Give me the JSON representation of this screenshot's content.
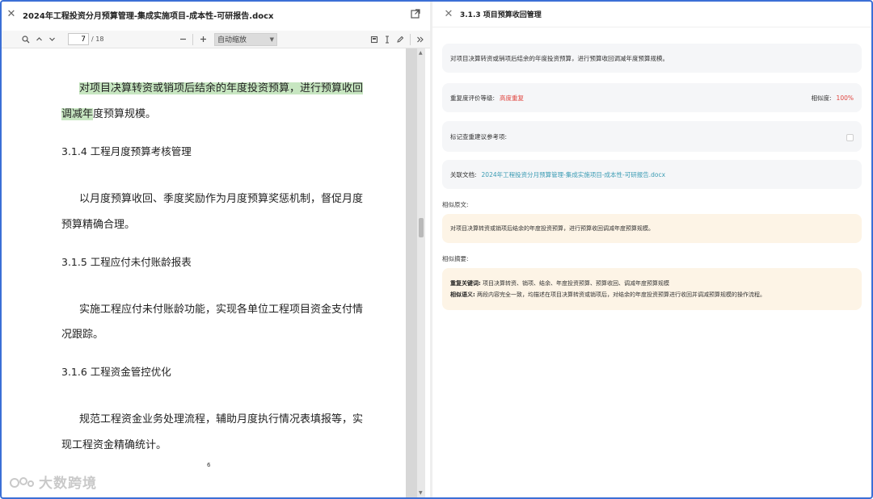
{
  "left": {
    "doc_title": "2024年工程投资分月预算管理-集成实施项目-成本性-可研报告.docx",
    "toolbar": {
      "page_current": "7",
      "page_total": "/ 18",
      "zoom": "自动缩放"
    },
    "document": {
      "para1_line1": "对项目决算转资或销项后结余的年度投资预算，进行预算收回",
      "para1_line2_hl": "调减年",
      "para1_line2_rest": "度预算规模。",
      "h314": "3.1.4 工程月度预算考核管理",
      "para2_line1": "以月度预算收回、季度奖励作为月度预算奖惩机制，督促月度",
      "para2_line2": "预算精确合理。",
      "h315": "3.1.5 工程应付未付账龄报表",
      "para3_line1": "实施工程应付未付账龄功能，实现各单位工程项目资金支付情",
      "para3_line2": "况跟踪。",
      "h316": "3.1.6 工程资金管控优化",
      "para4_line1": "规范工程资金业务处理流程，辅助月度执行情况表填报等，实",
      "para4_line2": "现工程资金精确统计。",
      "page_number": "6"
    },
    "watermark": "大数跨境"
  },
  "right": {
    "section_title": "3.1.3 项目预算收回管理",
    "card1_text": "对项目决算转资或销项后结余的年度投资预算，进行预算收回调减年度预算规模。",
    "card2": {
      "label": "重复度评价等级:",
      "level": "高度重复",
      "sim_label": "相似度:",
      "sim_value": "100%"
    },
    "card3_label": "标记查重建议参考项:",
    "card4": {
      "label": "关联文档:",
      "link": "2024年工程投资分月预算管理-集成实施项目-成本性-可研报告.docx"
    },
    "similar_text_label": "相似原文:",
    "similar_text": "对项目决算转资或销项后结余的年度投资预算，进行预算收回调减年度预算规模。",
    "similar_summary_label": "相似摘要:",
    "summary": {
      "kw_label": "重复关键词:",
      "kw_value": "项目决算转资、销项、结余、年度投资预算、预算收回、调减年度预算规模",
      "sem_label": "相似语义:",
      "sem_value": "两段内容完全一致，均描述在项目决算转资或销项后，对结余的年度投资预算进行收回并调减预算规模的操作流程。"
    }
  },
  "colors": {
    "highlight": "#c7e6c1",
    "danger": "#e0443e",
    "link": "#3a9bb3",
    "warm_card": "#fdf4e6",
    "card": "#f5f6f8"
  }
}
